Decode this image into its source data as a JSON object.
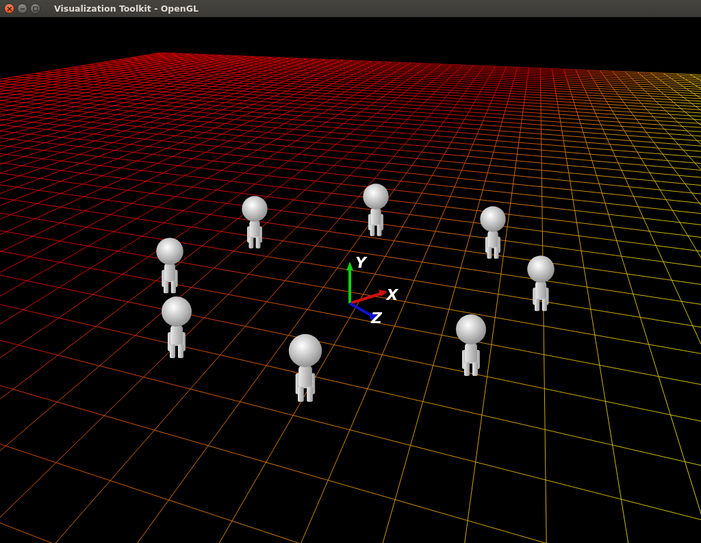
{
  "window": {
    "title": "Visualization Toolkit - OpenGL",
    "buttons": [
      {
        "kind": "close"
      },
      {
        "kind": "minimize"
      },
      {
        "kind": "maximize"
      }
    ]
  },
  "scene": {
    "axes": [
      {
        "kind": "x",
        "label": "X"
      },
      {
        "kind": "y",
        "label": "Y"
      },
      {
        "kind": "z",
        "label": "Z"
      }
    ]
  }
}
